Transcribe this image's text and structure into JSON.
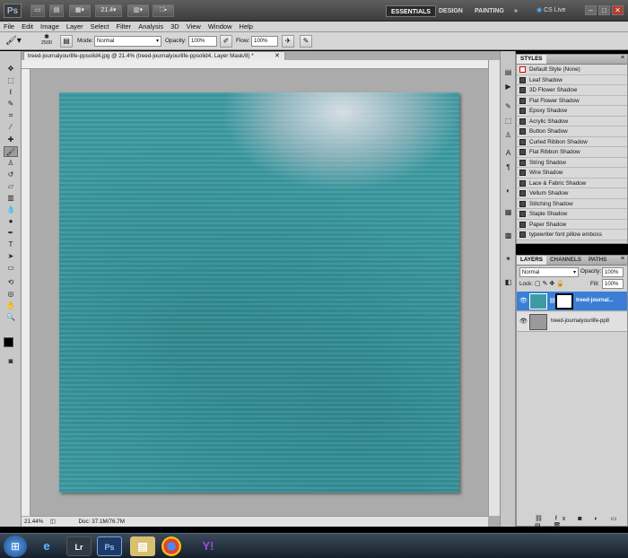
{
  "app": {
    "logo": "Ps",
    "zoom": "21.4",
    "workspaces": [
      "ESSENTIALS",
      "DESIGN",
      "PAINTING"
    ],
    "more": "»",
    "cs_live": "CS Live"
  },
  "menu": [
    "File",
    "Edit",
    "Image",
    "Layer",
    "Select",
    "Filter",
    "Analysis",
    "3D",
    "View",
    "Window",
    "Help"
  ],
  "options": {
    "brush_size": "2500",
    "mode_label": "Mode:",
    "mode_value": "Normal",
    "opacity_label": "Opacity:",
    "opacity_value": "100%",
    "flow_label": "Flow:",
    "flow_value": "100%"
  },
  "document": {
    "tab_title": "treed-journalyourlife-ppsolid4.jpg @ 21.4% (treed-journalyourlife-ppsolid4, Layer Mask/8) *",
    "zoom_status": "21.44%",
    "doc_size": "Doc: 37.1M/76.7M"
  },
  "styles": {
    "tab": "STYLES",
    "items": [
      "Default Style (None)",
      "Leaf Shadow",
      "3D Flower Shadow",
      "Flat Flower Shadow",
      "Epoxy Shadow",
      "Acrylic Shadow",
      "Button Shadow",
      "Curled Ribbon Shadow",
      "Flat Ribbon Shadow",
      "String Shadow",
      "Wire Shadow",
      "Lace & Fabric Shadow",
      "Vellum Shadow",
      "Stitching Shadow",
      "Staple Shadow",
      "Paper Shadow",
      "typewriter font pillow emboss"
    ]
  },
  "layers": {
    "tabs": [
      "LAYERS",
      "CHANNELS",
      "PATHS"
    ],
    "blend_mode": "Normal",
    "opacity_label": "Opacity:",
    "opacity_value": "100%",
    "lock_label": "Lock:",
    "fill_label": "Fill:",
    "fill_value": "100%",
    "items": [
      {
        "name": "treed-journal..."
      },
      {
        "name": "treed-journalyourlife-pp8"
      }
    ]
  },
  "taskbar": {
    "apps": [
      "Lr",
      "Ps"
    ]
  },
  "colors": {
    "canvas": "#3d9ca3",
    "selected_layer": "#3a7fd5"
  }
}
